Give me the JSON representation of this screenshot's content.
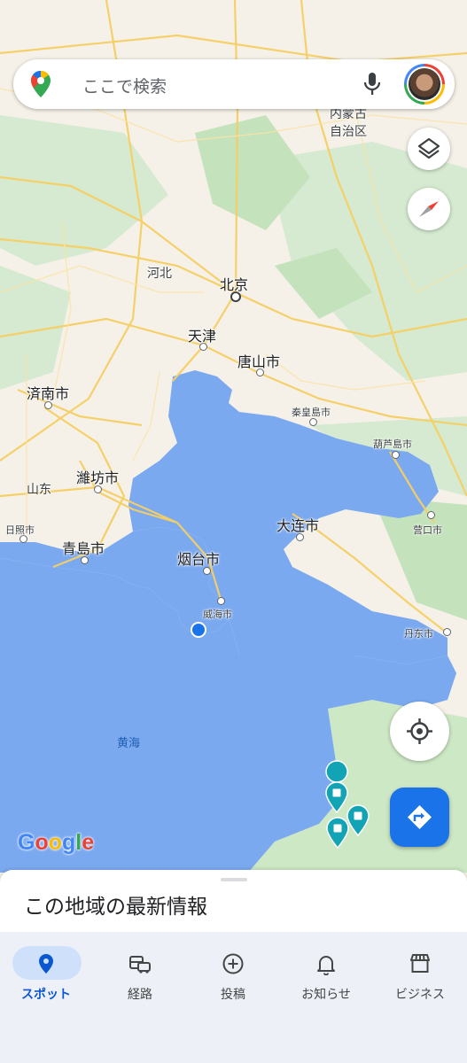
{
  "search": {
    "placeholder": "ここで検索"
  },
  "map": {
    "labels": {
      "inner_mongolia": "内蒙古",
      "inner_mongolia_2": "自治区",
      "hebei": "河北",
      "beijing": "北京",
      "tianjin": "天津",
      "tangshan": "唐山市",
      "jinan": "済南市",
      "qinhuangdao": "秦皇島市",
      "huludao": "葫芦島市",
      "weifang": "濰坊市",
      "shandong": "山东",
      "rizhao": "日照市",
      "qingdao": "青島市",
      "yantai": "烟台市",
      "dalian": "大连市",
      "yingkou": "营口市",
      "weihai": "威海市",
      "dandong": "丹东市",
      "yellow_sea": "黄海"
    },
    "attribution": "Google",
    "colors": {
      "water": "#7ba9f0",
      "land": "#f5f1e8",
      "green": "#c9e6c0",
      "road": "#f8d77a",
      "location": "#1a73e8",
      "pin": "#12a4b4"
    }
  },
  "sheet": {
    "title": "この地域の最新情報"
  },
  "nav": {
    "items": [
      {
        "label": "スポット",
        "icon": "pin-icon",
        "active": true
      },
      {
        "label": "経路",
        "icon": "commute-icon",
        "active": false
      },
      {
        "label": "投稿",
        "icon": "add-circle-icon",
        "active": false
      },
      {
        "label": "お知らせ",
        "icon": "bell-icon",
        "active": false
      },
      {
        "label": "ビジネス",
        "icon": "storefront-icon",
        "active": false
      }
    ]
  }
}
